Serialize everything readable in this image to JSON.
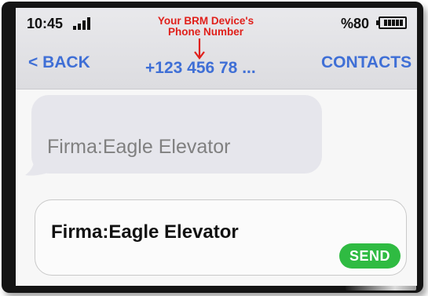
{
  "status_bar": {
    "time": "10:45",
    "battery_text": "%80"
  },
  "annotation": {
    "line1": "Your BRM Device's",
    "line2": "Phone Number"
  },
  "nav": {
    "back_label": "< BACK",
    "phone_number": "+123 456 78 ...",
    "contacts_label": "CONTACTS"
  },
  "message": {
    "received_text": "Firma:Eagle Elevator"
  },
  "compose": {
    "input_text": "Firma:Eagle Elevator",
    "send_label": "SEND"
  },
  "colors": {
    "link_blue": "#3f6fd6",
    "annotation_red": "#e0201b",
    "send_green": "#2fbb42"
  }
}
